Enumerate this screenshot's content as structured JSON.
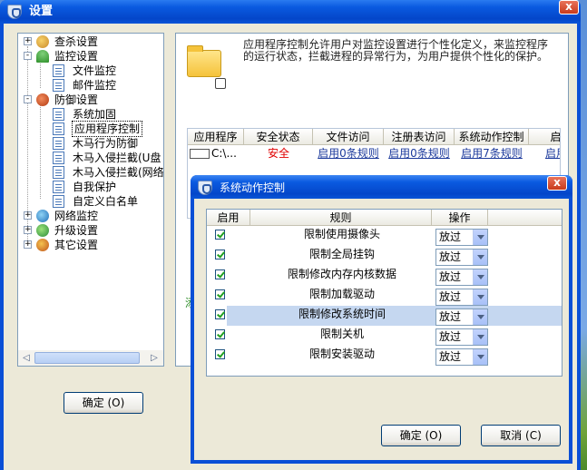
{
  "main": {
    "title": "设置",
    "close_label": "x",
    "ok_label": "确定 (O)"
  },
  "tree": [
    {
      "label": "查杀设置",
      "level": 0,
      "expander": "+",
      "icon": "search-bug-icon"
    },
    {
      "label": "监控设置",
      "level": 0,
      "expander": "-",
      "icon": "umbrella-icon"
    },
    {
      "label": "文件监控",
      "level": 1,
      "icon": "document-icon"
    },
    {
      "label": "邮件监控",
      "level": 1,
      "icon": "document-icon"
    },
    {
      "label": "防御设置",
      "level": 0,
      "expander": "-",
      "icon": "shield-glove-icon"
    },
    {
      "label": "系统加固",
      "level": 1,
      "icon": "document-icon"
    },
    {
      "label": "应用程序控制",
      "level": 1,
      "icon": "document-icon",
      "selected": true
    },
    {
      "label": "木马行为防御",
      "level": 1,
      "icon": "document-icon"
    },
    {
      "label": "木马入侵拦截(U盘",
      "level": 1,
      "icon": "document-icon"
    },
    {
      "label": "木马入侵拦截(网络",
      "level": 1,
      "icon": "document-icon"
    },
    {
      "label": "自我保护",
      "level": 1,
      "icon": "document-icon"
    },
    {
      "label": "自定义白名单",
      "level": 1,
      "icon": "document-icon"
    },
    {
      "label": "网络监控",
      "level": 0,
      "expander": "+",
      "icon": "globe-icon"
    },
    {
      "label": "升级设置",
      "level": 0,
      "expander": "+",
      "icon": "update-globe-icon"
    },
    {
      "label": "其它设置",
      "level": 0,
      "expander": "+",
      "icon": "gear-icon"
    }
  ],
  "panel": {
    "description": "应用程序控制允许用户对监控设置进行个性化定义，来监控程序的运行状态，拦截进程的异常行为，为用户提供个性化的保护。",
    "columns": [
      "应用程序",
      "安全状态",
      "文件访问",
      "注册表访问",
      "系统动作控制",
      "启"
    ],
    "row": {
      "app": "C:\\...",
      "status": "安全",
      "file": "启用0条规则",
      "registry": "启用0条规则",
      "sysaction": "启用7条规则",
      "extra": "启用"
    },
    "green_text": "添"
  },
  "dialog": {
    "title": "系统动作控制",
    "close_label": "x",
    "columns": [
      "启用",
      "规则",
      "操作"
    ],
    "rules": [
      {
        "name": "限制使用摄像头",
        "action": "放过",
        "checked": true
      },
      {
        "name": "限制全局挂钩",
        "action": "放过",
        "checked": true
      },
      {
        "name": "限制修改内存内核数据",
        "action": "放过",
        "checked": true
      },
      {
        "name": "限制加载驱动",
        "action": "放过",
        "checked": true
      },
      {
        "name": "限制修改系统时间",
        "action": "放过",
        "checked": true
      },
      {
        "name": "限制关机",
        "action": "放过",
        "checked": true
      },
      {
        "name": "限制安装驱动",
        "action": "放过",
        "checked": true
      }
    ],
    "ok_label": "确定 (O)",
    "cancel_label": "取消 (C)"
  }
}
